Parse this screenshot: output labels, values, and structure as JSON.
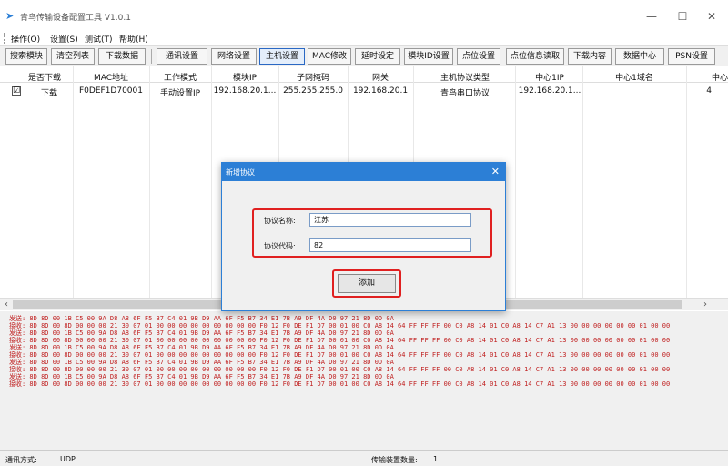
{
  "window": {
    "title": "青鸟传输设备配置工具 V1.0.1",
    "controls": {
      "minimize": "—",
      "maximize": "☐",
      "close": "✕"
    }
  },
  "menu": [
    {
      "label": "操作(O)"
    },
    {
      "label": "设置(S)"
    },
    {
      "label": "测试(T)"
    },
    {
      "label": "帮助(H)"
    }
  ],
  "toolbar": [
    {
      "label": "搜索模块"
    },
    {
      "label": "清空列表"
    },
    {
      "label": "下载数据"
    },
    {
      "label": "通讯设置"
    },
    {
      "label": "网络设置"
    },
    {
      "label": "主机设置",
      "active": true
    },
    {
      "label": "MAC修改"
    },
    {
      "label": "延时设定"
    },
    {
      "label": "模块ID设置"
    },
    {
      "label": "点位设置"
    },
    {
      "label": "点位信息读取"
    },
    {
      "label": "下载内容"
    },
    {
      "label": "数据中心"
    },
    {
      "label": "PSN设置"
    }
  ],
  "grid": {
    "columns": [
      "是否下载",
      "MAC地址",
      "工作模式",
      "模块IP",
      "子网掩码",
      "网关",
      "主机协议类型",
      "中心1IP",
      "中心1域名",
      "中心"
    ],
    "rows": [
      {
        "checked": "☑",
        "cells": [
          "下载",
          "F0DEF1D70001",
          "手动设置IP",
          "192.168.20.1...",
          "255.255.255.0",
          "192.168.20.1",
          "青鸟串口协议",
          "192.168.20.1...",
          "",
          "4"
        ]
      }
    ]
  },
  "scroll": {
    "left": "‹",
    "right": "›"
  },
  "log": [
    "发送: 8D 8D 00 1B C5 00 9A D8 A8 6F F5 B7 C4 01 9B D9 AA 6F F5 B7 34 E1 7B A9 DF 4A D0 97 21 8D 0D 0A",
    "接收: 8D 8D 00 8D 00 00 00 21 30 07 01 00 00 00 00 00 00 00 00 00 F0 12 F0 DE F1 D7 00 01 00 C0 A8 14 64 FF FF FF 00 C0 A8 14 01 C0 A8 14 C7 A1 13 00 00 00 00 00 00 01 00 00",
    "发送: 8D 8D 00 1B C5 00 9A D8 A8 6F F5 B7 C4 01 9B D9 AA 6F F5 B7 34 E1 7B A9 DF 4A D0 97 21 8D 0D 0A",
    "接收: 8D 8D 00 8D 00 00 00 21 30 07 01 00 00 00 00 00 00 00 00 00 F0 12 F0 DE F1 D7 00 01 00 C0 A8 14 64 FF FF FF 00 C0 A8 14 01 C0 A8 14 C7 A1 13 00 00 00 00 00 00 01 00 00",
    "发送: 8D 8D 00 1B C5 00 9A D8 A8 6F F5 B7 C4 01 9B D9 AA 6F F5 B7 34 E1 7B A9 DF 4A D0 97 21 8D 0D 0A",
    "接收: 8D 8D 00 8D 00 00 00 21 30 07 01 00 00 00 00 00 00 00 00 00 F0 12 F0 DE F1 D7 00 01 00 C0 A8 14 64 FF FF FF 00 C0 A8 14 01 C0 A8 14 C7 A1 13 00 00 00 00 00 00 01 00 00",
    "发送: 8D 8D 00 1B C5 00 9A D8 A8 6F F5 B7 C4 01 9B D9 AA 6F F5 B7 34 E1 7B A9 DF 4A D0 97 21 8D 0D 0A",
    "接收: 8D 8D 00 8D 00 00 00 21 30 07 01 00 00 00 00 00 00 00 00 00 F0 12 F0 DE F1 D7 00 01 00 C0 A8 14 64 FF FF FF 00 C0 A8 14 01 C0 A8 14 C7 A1 13 00 00 00 00 00 00 01 00 00",
    "发送: 8D 8D 00 1B C5 00 9A D8 A8 6F F5 B7 C4 01 9B D9 AA 6F F5 B7 34 E1 7B A9 DF 4A D0 97 21 8D 0D 0A",
    "接收: 8D 8D 00 8D 00 00 00 21 30 07 01 00 00 00 00 00 00 00 00 00 F0 12 F0 DE F1 D7 00 01 00 C0 A8 14 64 FF FF FF 00 C0 A8 14 01 C0 A8 14 C7 A1 13 00 00 00 00 00 00 01 00 00"
  ],
  "status": {
    "comm_label": "通讯方式:",
    "comm_value": "UDP",
    "count_label": "传输装置数量:",
    "count_value": "1"
  },
  "dialog": {
    "title": "新增协议",
    "close": "✕",
    "name_label": "协议名称:",
    "name_value": "江苏",
    "code_label": "协议代码:",
    "code_value": "82",
    "add_button": "添加"
  },
  "colors": {
    "accent": "#2c7fd6",
    "highlight_border": "#e02020",
    "log_text": "#c02020"
  }
}
